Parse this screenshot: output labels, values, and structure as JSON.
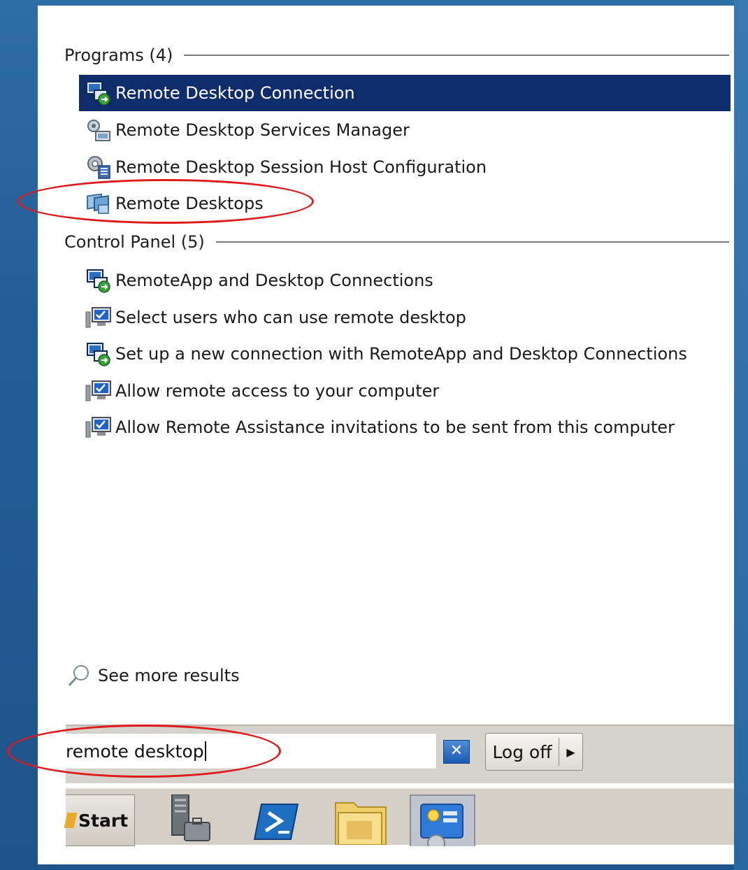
{
  "start_menu": {
    "programs": {
      "header": "Programs (4)",
      "items": [
        {
          "label": "Remote Desktop Connection",
          "icon": "remote-desktop-connection-icon",
          "selected": true
        },
        {
          "label": "Remote Desktop Services Manager",
          "icon": "services-manager-icon",
          "selected": false
        },
        {
          "label": "Remote Desktop Session Host Configuration",
          "icon": "session-host-config-icon",
          "selected": false
        },
        {
          "label": "Remote Desktops",
          "icon": "remote-desktops-icon",
          "selected": false
        }
      ]
    },
    "control_panel": {
      "header": "Control Panel (5)",
      "items": [
        {
          "label": "RemoteApp and Desktop Connections",
          "icon": "remoteapp-icon"
        },
        {
          "label": "Select users who can use remote desktop",
          "icon": "system-monitor-icon"
        },
        {
          "label": "Set up a new connection with RemoteApp and Desktop Connections",
          "icon": "remoteapp-icon"
        },
        {
          "label": "Allow remote access to your computer",
          "icon": "system-monitor-icon"
        },
        {
          "label": "Allow Remote Assistance invitations to be sent from this computer",
          "icon": "system-monitor-icon"
        }
      ]
    },
    "see_more": "See more results",
    "search": {
      "value": "remote desktop",
      "clear_icon": "clear-icon"
    },
    "logoff": {
      "label": "Log off",
      "arrow_icon": "arrow-right-icon"
    }
  },
  "taskbar": {
    "start_label": "Start",
    "icons": [
      "server-manager-icon",
      "powershell-icon",
      "explorer-folder-icon",
      "control-panel-icon"
    ]
  },
  "colors": {
    "selection": "#0f2c6b",
    "annotation": "#dd1b1b",
    "desktop": "#235c96"
  }
}
